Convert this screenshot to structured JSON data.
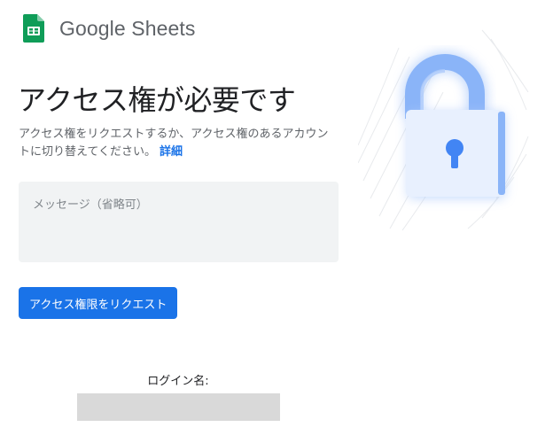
{
  "header": {
    "product_name": "Google Sheets",
    "logo_icon": "google-sheets-logo-icon",
    "logo_color": "#0f9d58"
  },
  "main": {
    "title": "アクセス権が必要です",
    "description": "アクセス権をリクエストするか、アクセス権のあるアカウントに切り替えてください。",
    "details_link": "詳細",
    "message_placeholder": "メッセージ（省略可）",
    "request_button_label": "アクセス権限をリクエスト"
  },
  "login": {
    "label": "ログイン名:",
    "value": ""
  },
  "illustration": {
    "icon": "padlock-icon"
  },
  "colors": {
    "accent": "#1a73e8",
    "lock_body": "#e8f0fe",
    "lock_shackle": "#8ab4f8",
    "field_background": "#f1f3f4"
  }
}
